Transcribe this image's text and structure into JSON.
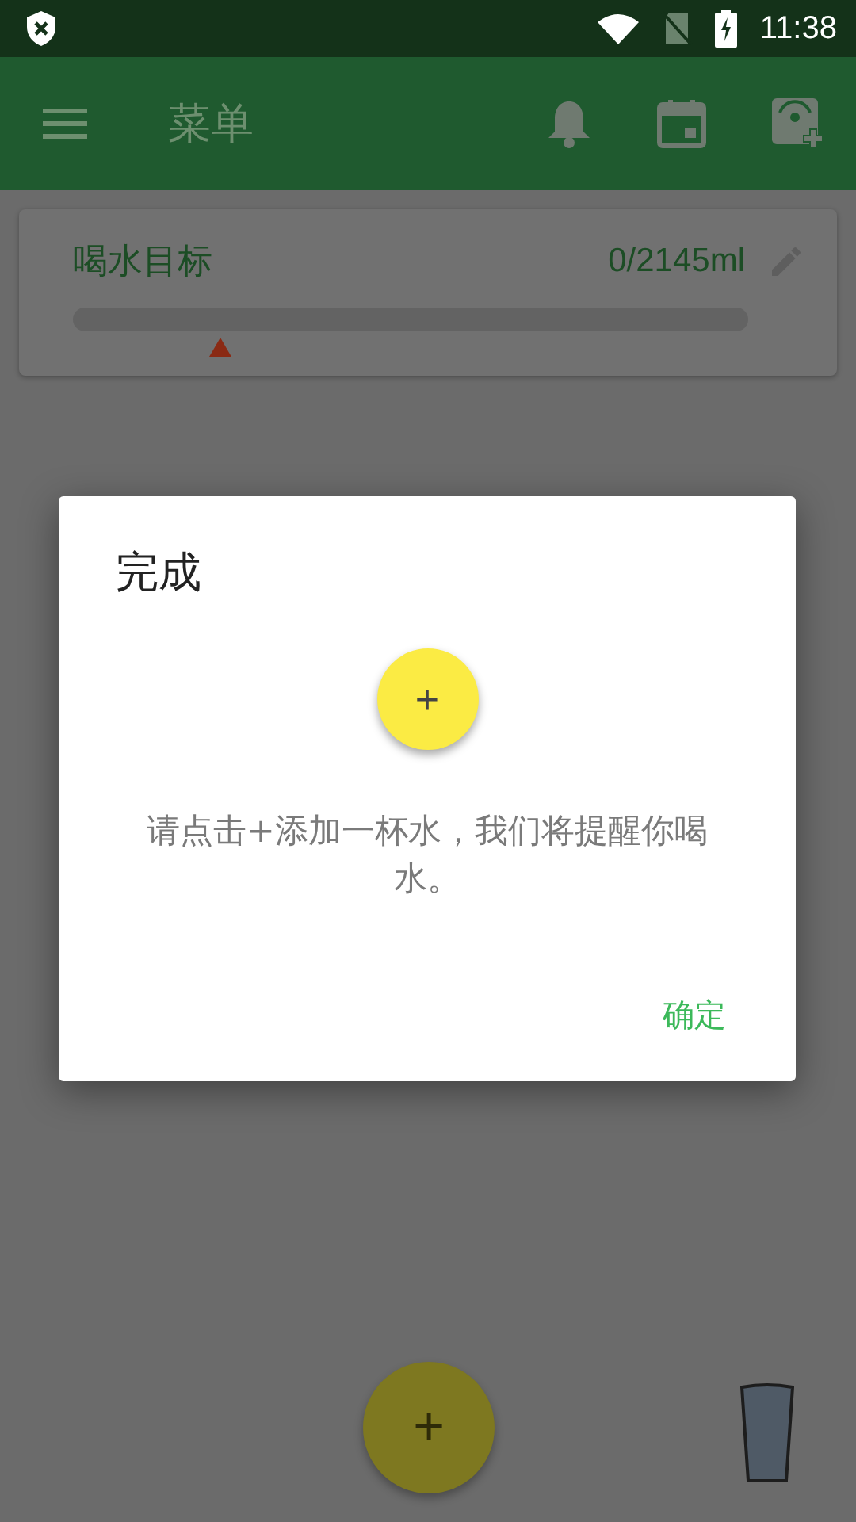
{
  "status_bar": {
    "time": "11:38"
  },
  "toolbar": {
    "title": "菜单"
  },
  "goal_card": {
    "title": "喝水目标",
    "amount": "0/2145ml",
    "level": 0
  },
  "dialog": {
    "title": "完成",
    "fab_label": "+",
    "message": "请点击+添加一杯水，我们将提醒你喝水。",
    "button": "确定"
  },
  "fab": {
    "label": "+"
  }
}
